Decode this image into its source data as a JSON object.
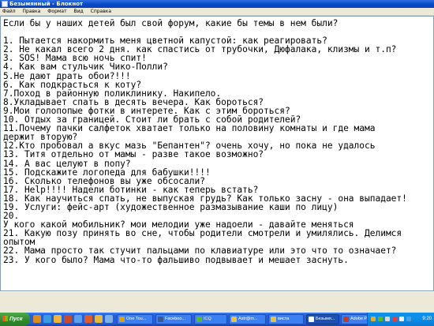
{
  "window": {
    "title": "Безымянный - Блокнот"
  },
  "menu": {
    "items": [
      "Файл",
      "Правка",
      "Формат",
      "Вид",
      "Справка"
    ]
  },
  "editor": {
    "lines": [
      "Если бы у наших детей был свой форум, какие бы темы в нем были?",
      "",
      "1. Пытается накормить меня цветной капустой: как реагировать?",
      "2. Не какал всего 2 дня. как спастись от трубочки, Дюфалака, клизмы и т.п?",
      "3. SOS! Мама всю ночь спит!",
      "4. Как вам стульчик Чико-Полли?",
      "5.Не дают драть обои?!!!",
      "6. Как подкрасться к коту?",
      "7.Поход в районную поликлинику. Накипело.",
      "8.Укладывает спать в десять вечера. Как бороться?",
      "9.Мои голопопые фотки в интерете. Как с этим бороться?",
      "10. Отдых за границей. Стоит ли брать с собой родителей?",
      "11.Почему пачки салфеток хватает только на половину комнаты и где мама",
      "держит вторую?",
      "12.Кто пробовал а вкус мазь \"Бепантен\"? очень хочу, но пока не удалось",
      "13. Титя отдельно от мамы - разве такое возможно?",
      "14. А вас целуют в попу?",
      "15. Подскажите логопеда для бабушки!!!!",
      "16. Сколько телефонов вы уже обсосали?",
      "17. Help!!!! Надели ботинки - как теперь встать?",
      "18. Как научиться спать, не выпуская грудь? Как только засну - она выпадает!",
      "19. Услуги: фейс-арт (художественное размазывание каши по лицу)",
      "20.",
      "У кого какой мобильник? мои мелодии уже надоели - давайте меняться",
      "21. Какую позу принять во сне, чтобы родители смотрели и умилялись. Делимся",
      "опытом",
      "22. Мама просто так стучит пальцами по клавиатуре или это что то означает?",
      "23. У кого было? Мама что-то фальшиво подвывает и мешает заснуть."
    ]
  },
  "taskbar": {
    "start_label": "Пуск",
    "tasks": [
      {
        "label": "One Tou...",
        "icon_color": "#d9a020"
      },
      {
        "label": "Faceboo...",
        "icon_color": "#3b5998"
      },
      {
        "label": "ICQ",
        "icon_color": "#5cb82a"
      },
      {
        "label": "Astr@m...",
        "icon_color": "#e6c24a"
      },
      {
        "label": "виста",
        "icon_color": "#e6c24a"
      },
      {
        "label": "Безымя...",
        "icon_color": "#ffffff"
      },
      {
        "label": "Adobe P...",
        "icon_color": "#c0392b"
      }
    ],
    "clock": "9:20"
  },
  "colors": {
    "title_bar": "#0a48c8",
    "taskbar": "#245edb",
    "start_button": "#2f8a2c",
    "tray": "#0d8dea"
  }
}
